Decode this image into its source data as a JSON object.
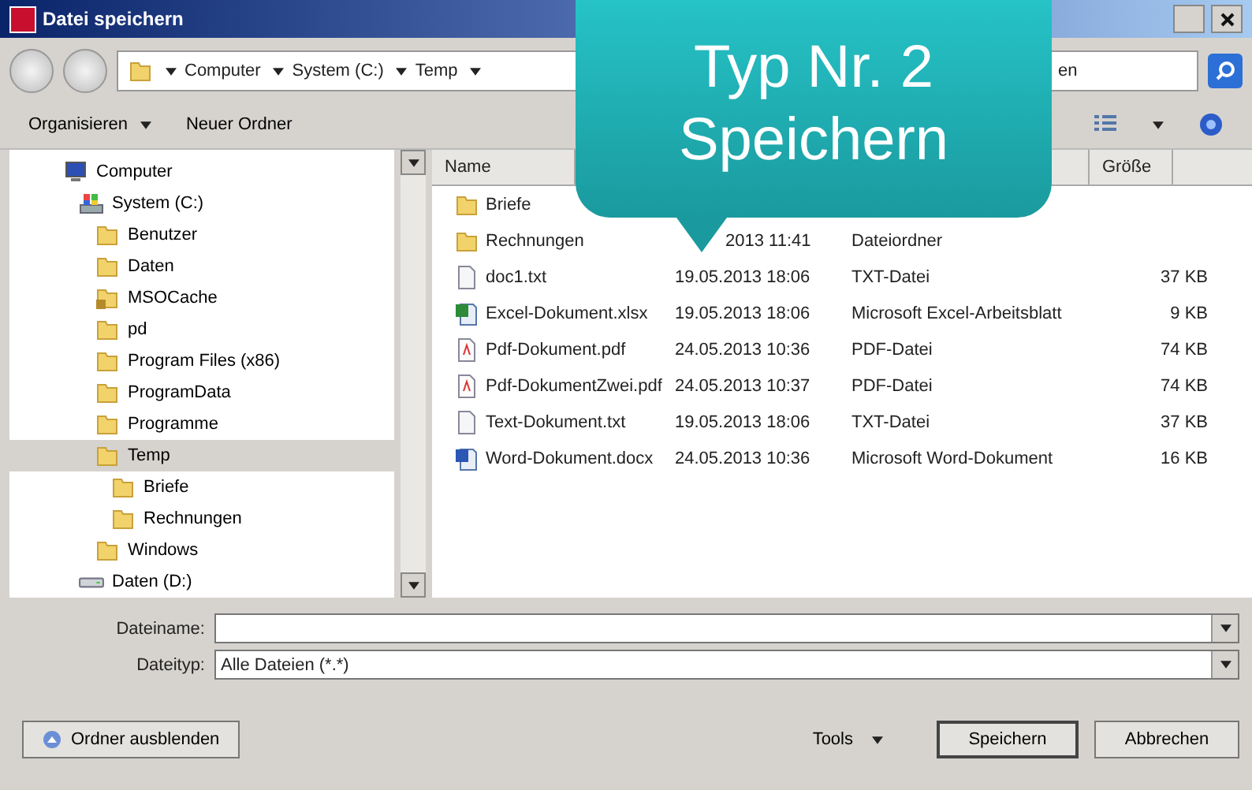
{
  "window": {
    "title": "Datei speichern"
  },
  "breadcrumb": [
    "Computer",
    "System (C:)",
    "Temp"
  ],
  "search": {
    "value": "en"
  },
  "toolbar": {
    "items": [
      "Organisieren",
      "Neuer Ordner"
    ]
  },
  "tree": [
    {
      "label": "Computer",
      "kind": "computer",
      "selected": false,
      "children": [
        {
          "label": "System (C:)",
          "kind": "system-drive",
          "selected": false,
          "children": [
            {
              "label": "Benutzer",
              "kind": "folder",
              "selected": false
            },
            {
              "label": "Daten",
              "kind": "folder",
              "selected": false
            },
            {
              "label": "MSOCache",
              "kind": "locked-folder",
              "selected": false
            },
            {
              "label": "pd",
              "kind": "folder",
              "selected": false
            },
            {
              "label": "Program Files (x86)",
              "kind": "folder",
              "selected": false
            },
            {
              "label": "ProgramData",
              "kind": "folder",
              "selected": false
            },
            {
              "label": "Programme",
              "kind": "folder",
              "selected": false
            },
            {
              "label": "Temp",
              "kind": "folder",
              "selected": true,
              "children": [
                {
                  "label": "Briefe",
                  "kind": "folder",
                  "selected": false
                },
                {
                  "label": "Rechnungen",
                  "kind": "folder",
                  "selected": false
                }
              ]
            },
            {
              "label": "Windows",
              "kind": "folder",
              "selected": false
            }
          ]
        },
        {
          "label": "Daten (D:)",
          "kind": "drive",
          "selected": false
        }
      ]
    }
  ],
  "table": {
    "columns": [
      "Name",
      "Größe"
    ],
    "rows": [
      {
        "kind": "folder",
        "name": "Briefe"
      },
      {
        "kind": "folder",
        "name": "Rechnungen",
        "date": "2013 11:41",
        "date_covered": true,
        "type": "Dateiordner"
      },
      {
        "kind": "text",
        "name": "doc1.txt",
        "date": "19.05.2013 18:06",
        "type": "TXT-Datei",
        "size": "37 KB"
      },
      {
        "kind": "excel",
        "name": "Excel-Dokument.xlsx",
        "date": "19.05.2013 18:06",
        "type": "Microsoft Excel-Arbeitsblatt",
        "size": "9 KB"
      },
      {
        "kind": "pdf",
        "name": "Pdf-Dokument.pdf",
        "date": "24.05.2013 10:36",
        "type": "PDF-Datei",
        "size": "74 KB"
      },
      {
        "kind": "pdf",
        "name": "Pdf-DokumentZwei.pdf",
        "date": "24.05.2013 10:37",
        "type": "PDF-Datei",
        "size": "74 KB"
      },
      {
        "kind": "text",
        "name": "Text-Dokument.txt",
        "date": "19.05.2013 18:06",
        "type": "TXT-Datei",
        "size": "37 KB"
      },
      {
        "kind": "word",
        "name": "Word-Dokument.docx",
        "date": "24.05.2013 10:36",
        "type": "Microsoft Word-Dokument",
        "size": "16 KB"
      }
    ]
  },
  "form": {
    "filename_label": "Dateiname:",
    "filetype_label": "Dateityp:",
    "filetype": "Alle Dateien (*.*)"
  },
  "footer": {
    "hide_folders": "Ordner ausblenden",
    "tools": "Tools",
    "save": "Speichern",
    "cancel": "Abbrechen"
  },
  "callout": {
    "lines": [
      "Typ Nr. 2",
      "Speichern"
    ]
  }
}
